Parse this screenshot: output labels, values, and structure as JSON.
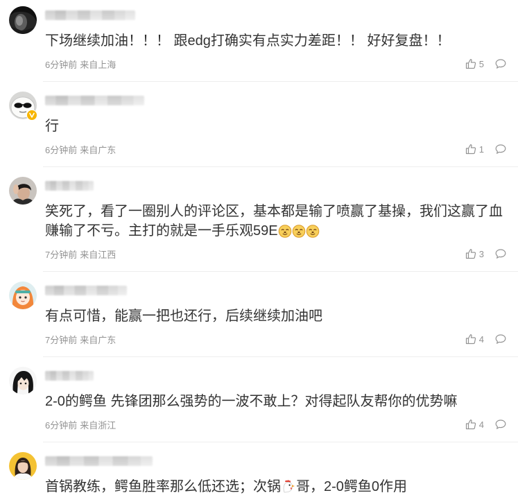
{
  "colors": {
    "text": "#333333",
    "meta": "#939393",
    "divider": "#eeeeee",
    "verified_badge": "#f7b500"
  },
  "icons": {
    "like": "thumbs-up-icon",
    "reply": "comment-icon",
    "verified": "verified-badge-icon"
  },
  "comments": [
    {
      "text": "下场继续加油！！！ 跟edg打确实有点实力差距！！ 好好复盘！！",
      "time": "6分钟前",
      "source": "来自上海",
      "likes": "5",
      "verified": false
    },
    {
      "text": "行",
      "time": "6分钟前",
      "source": "来自广东",
      "likes": "1",
      "verified": true
    },
    {
      "text": "笑死了，看了一圈别人的评论区，基本都是输了喷赢了基操，我们这赢了血赚输了不亏。主打的就是一手乐观59E",
      "emoji": [
        "face-emoji",
        "face-emoji",
        "face-emoji"
      ],
      "time": "7分钟前",
      "source": "来自江西",
      "likes": "3",
      "verified": false
    },
    {
      "text": "有点可惜，能赢一把也还行，后续继续加油吧",
      "time": "7分钟前",
      "source": "来自广东",
      "likes": "4",
      "verified": false
    },
    {
      "text": "2-0的鳄鱼 先锋团那么强势的一波不敢上？对得起队友帮你的优势嘛",
      "time": "6分钟前",
      "source": "来自浙江",
      "likes": "4",
      "verified": false
    },
    {
      "text_before": "首锅教练，鳄鱼胜率那么低还选；次锅",
      "emoji": [
        "chicken-emoji"
      ],
      "text_after": "哥，2-0鳄鱼0作用",
      "verified": false
    }
  ]
}
